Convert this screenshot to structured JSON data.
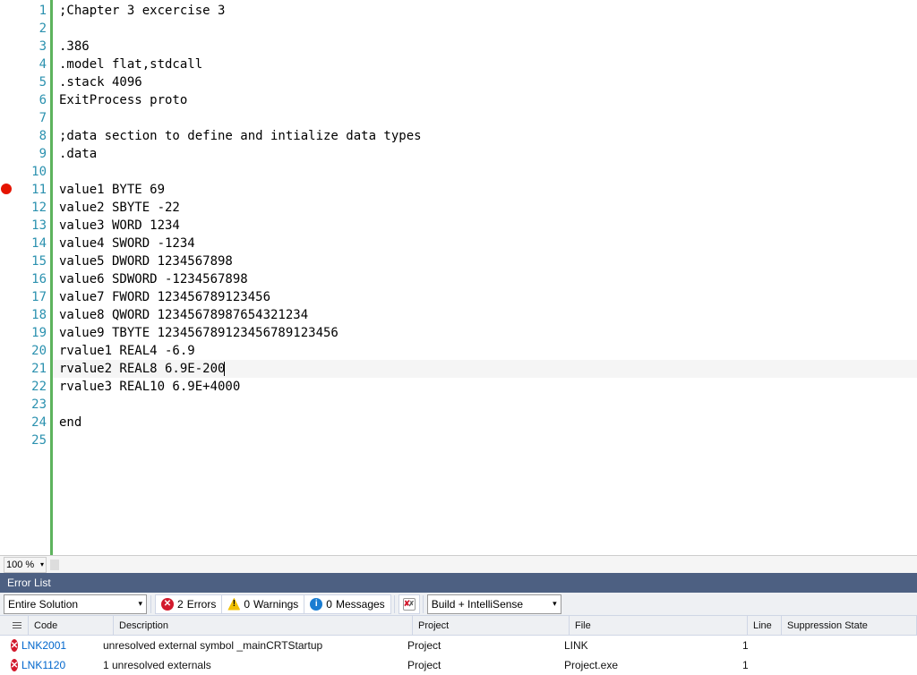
{
  "editor": {
    "breakpoint_line": 11,
    "current_line": 21,
    "lines": [
      ";Chapter 3 excercise 3",
      "",
      ".386",
      ".model flat,stdcall",
      ".stack 4096",
      "ExitProcess proto",
      "",
      ";data section to define and intialize data types",
      ".data",
      "",
      "value1 BYTE 69",
      "value2 SBYTE -22",
      "value3 WORD 1234",
      "value4 SWORD -1234",
      "value5 DWORD 1234567898",
      "value6 SDWORD -1234567898",
      "value7 FWORD 123456789123456",
      "value8 QWORD 12345678987654321234",
      "value9 TBYTE 123456789123456789123456",
      "rvalue1 REAL4 -6.9",
      "rvalue2 REAL8 6.9E-200",
      "rvalue3 REAL10 6.9E+4000",
      "",
      "end",
      ""
    ]
  },
  "zoom": {
    "label": "100 %"
  },
  "errorList": {
    "title": "Error List",
    "scope": "Entire Solution",
    "filters": {
      "errors": {
        "count": 2,
        "label": "Errors"
      },
      "warnings": {
        "count": 0,
        "label": "Warnings"
      },
      "messages": {
        "count": 0,
        "label": "Messages"
      }
    },
    "intellisense": "Build + IntelliSense",
    "columns": {
      "code": "Code",
      "description": "Description",
      "project": "Project",
      "file": "File",
      "line": "Line",
      "suppression": "Suppression State"
    },
    "rows": [
      {
        "code": "LNK2001",
        "desc": "unresolved external symbol _mainCRTStartup",
        "project": "Project",
        "file": "LINK",
        "line": "1",
        "supp": ""
      },
      {
        "code": "LNK1120",
        "desc": "1 unresolved externals",
        "project": "Project",
        "file": "Project.exe",
        "line": "1",
        "supp": ""
      }
    ]
  }
}
